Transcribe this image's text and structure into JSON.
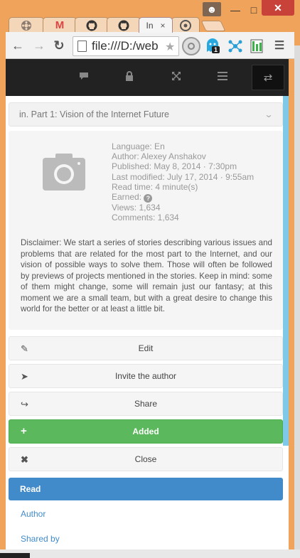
{
  "browser": {
    "tabs": [
      {
        "label": "",
        "icon": "gear-icon"
      },
      {
        "label": "M",
        "icon": "gmail-icon"
      },
      {
        "label": "",
        "icon": "github-icon"
      },
      {
        "label": "",
        "icon": "github-icon"
      },
      {
        "label": "In",
        "icon": "page-icon"
      },
      {
        "label": "",
        "icon": "target-icon"
      }
    ],
    "tab_close_glyph": "×",
    "url": "file:///D:/web",
    "badge_count": "1"
  },
  "chapter": {
    "title": "in. Part 1: Vision of the Internet Future"
  },
  "story": {
    "meta": [
      "Language: En",
      "Author: Alexey Anshakov",
      "Published: May 8, 2014 · 7:30pm",
      "Last modified: July 17, 2014 · 9:55am",
      "Read time: 4 minute(s)"
    ],
    "earned_label": "Earned:",
    "earned_help": "?",
    "views": "Views: 1,634",
    "comments": "Comments: 1,634",
    "disclaimer": "Disclaimer: We start a series of stories describing various issues and problems that are related for the most part to the Internet, and our vision of possible ways to solve them. Those will often be followed by previews of projects mentioned in the stories. Keep in mind: some of them might change, some will remain just our fantasy; at this moment we are a small team, but with a great desire to change this world for the better or at least a little bit."
  },
  "actions": {
    "edit": "Edit",
    "invite": "Invite the author",
    "share": "Share",
    "added": "Added",
    "close": "Close",
    "read": "Read"
  },
  "links": {
    "author": "Author",
    "shared_by": "Shared by"
  },
  "colors": {
    "window_frame": "#f0a35b",
    "nav_bg": "#222222",
    "added_green": "#5cb85c",
    "read_blue": "#428bca",
    "close_red": "#c8423a"
  }
}
